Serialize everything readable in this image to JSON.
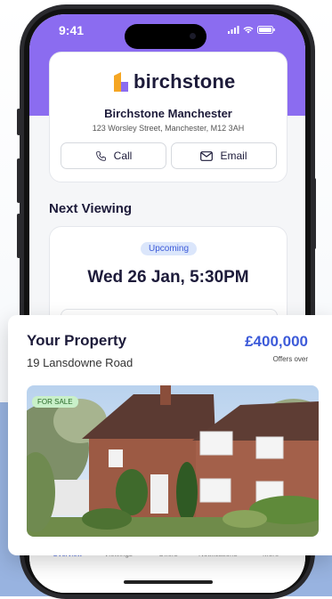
{
  "status_bar": {
    "time": "9:41"
  },
  "agent": {
    "brand": "birchstone",
    "office_name": "Birchstone Manchester",
    "address": "123 Worsley Street, Manchester, M12 3AH",
    "call_label": "Call",
    "email_label": "Email"
  },
  "viewing": {
    "section_title": "Next Viewing",
    "status": "Upcoming",
    "date": "Wed 26 Jan, 5:30PM"
  },
  "tabs": [
    {
      "label": "Overview",
      "active": true
    },
    {
      "label": "Viewings"
    },
    {
      "label": "Offers"
    },
    {
      "label": "Notifications"
    },
    {
      "label": "More"
    }
  ],
  "property": {
    "title": "Your Property",
    "address": "19 Lansdowne Road",
    "price": "£400,000",
    "price_note": "Offers over",
    "status_badge": "FOR SALE"
  },
  "colors": {
    "accent": "#3d5bd9",
    "header_purple": "#8b6cf0",
    "sale_badge_bg": "#c9f0c9"
  }
}
